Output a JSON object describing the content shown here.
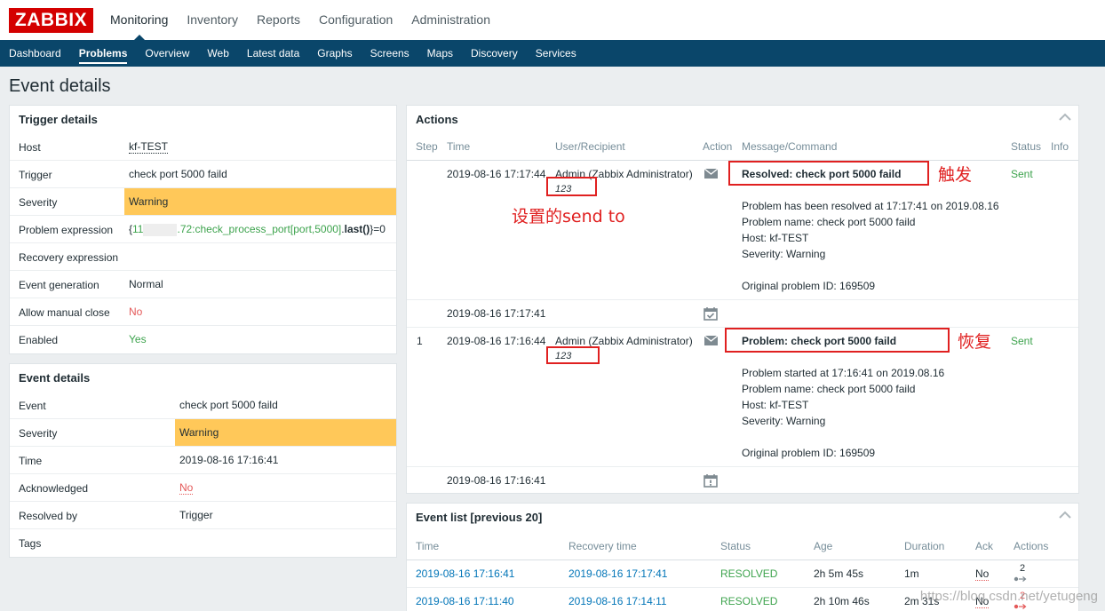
{
  "header": {
    "logo": "ZABBIX",
    "menu": [
      "Monitoring",
      "Inventory",
      "Reports",
      "Configuration",
      "Administration"
    ],
    "active_menu": "Monitoring"
  },
  "subnav": {
    "items": [
      "Dashboard",
      "Problems",
      "Overview",
      "Web",
      "Latest data",
      "Graphs",
      "Screens",
      "Maps",
      "Discovery",
      "Services"
    ],
    "active": "Problems"
  },
  "page_title": "Event details",
  "trigger_details": {
    "title": "Trigger details",
    "rows": [
      {
        "label": "Host",
        "value": "kf-TEST"
      },
      {
        "label": "Trigger",
        "value": "check port 5000 faild"
      },
      {
        "label": "Severity",
        "value": "Warning"
      },
      {
        "label": "Problem expression",
        "value": ""
      },
      {
        "label": "Recovery expression",
        "value": ""
      },
      {
        "label": "Event generation",
        "value": "Normal"
      },
      {
        "label": "Allow manual close",
        "value": "No"
      },
      {
        "label": "Enabled",
        "value": "Yes"
      }
    ],
    "expression": {
      "open": "{",
      "host": "11",
      "item": ".72:check_process_port[port,5000]",
      "func": "last()",
      "close": "}=0"
    }
  },
  "event_details": {
    "title": "Event details",
    "rows": [
      {
        "label": "Event",
        "value": "check port 5000 faild"
      },
      {
        "label": "Severity",
        "value": "Warning"
      },
      {
        "label": "Time",
        "value": "2019-08-16 17:16:41"
      },
      {
        "label": "Acknowledged",
        "value": "No"
      },
      {
        "label": "Resolved by",
        "value": "Trigger"
      },
      {
        "label": "Tags",
        "value": ""
      }
    ]
  },
  "actions": {
    "title": "Actions",
    "columns": [
      "Step",
      "Time",
      "User/Recipient",
      "Action",
      "Message/Command",
      "Status",
      "Info"
    ],
    "rows": [
      {
        "step": "",
        "time": "2019-08-16 17:17:44",
        "user": "Admin (Zabbix Administrator)",
        "sendto": "123",
        "action_icon": "envelope-icon",
        "subject": "Resolved: check port 5000 faild",
        "body": [
          "Problem has been resolved at 17:17:41 on 2019.08.16",
          "Problem name: check port 5000 faild",
          "Host: kf-TEST",
          "Severity: Warning",
          "",
          "Original problem ID: 169509"
        ],
        "status": "Sent"
      },
      {
        "step": "",
        "time": "2019-08-16 17:17:41",
        "action_icon": "calendar-check-icon"
      },
      {
        "step": "1",
        "time": "2019-08-16 17:16:44",
        "user": "Admin (Zabbix Administrator)",
        "sendto": "123",
        "action_icon": "envelope-icon",
        "subject": "Problem: check port 5000 faild",
        "body": [
          "Problem started at 17:16:41 on 2019.08.16",
          "Problem name: check port 5000 faild",
          "Host: kf-TEST",
          "Severity: Warning",
          "",
          "Original problem ID: 169509"
        ],
        "status": "Sent"
      },
      {
        "step": "",
        "time": "2019-08-16 17:16:41",
        "action_icon": "calendar-alert-icon"
      }
    ]
  },
  "annotations": {
    "trigger": "触发",
    "sendto": "设置的send to",
    "recovery": "恢复"
  },
  "event_list": {
    "title": "Event list [previous 20]",
    "columns": [
      "Time",
      "Recovery time",
      "Status",
      "Age",
      "Duration",
      "Ack",
      "Actions"
    ],
    "rows": [
      {
        "time": "2019-08-16 17:16:41",
        "recovery": "2019-08-16 17:17:41",
        "status": "RESOLVED",
        "age": "2h 5m 45s",
        "duration": "1m",
        "ack": "No",
        "actions": "2"
      },
      {
        "time": "2019-08-16 17:11:40",
        "recovery": "2019-08-16 17:14:11",
        "status": "RESOLVED",
        "age": "2h 10m 46s",
        "duration": "2m 31s",
        "ack": "No",
        "actions": "2"
      }
    ]
  },
  "watermark": "https://blog.csdn.net/yetugeng",
  "colors": {
    "brand": "#d40000",
    "nav": "#0a466a",
    "warning": "#ffc859",
    "ok": "#3da34d",
    "no": "#e45959",
    "annotation": "#e02020",
    "link": "#0275b8"
  }
}
